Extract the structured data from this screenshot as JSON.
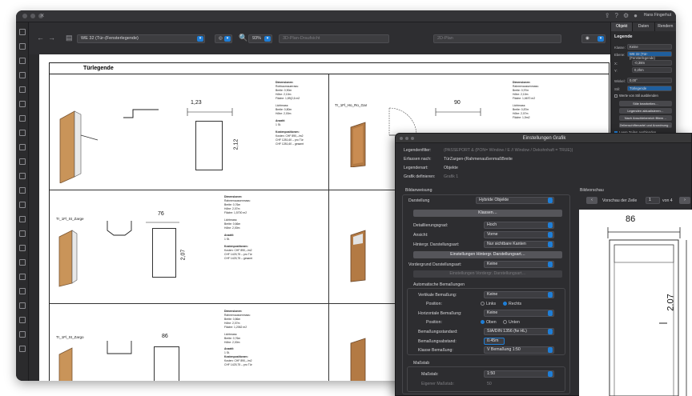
{
  "window": {
    "user_label": "Hans Fingerhut"
  },
  "toolbar": {
    "layer_prefix": "WE 32",
    "layer_name": "WE 32 (Tür-(Fensterlegende)",
    "zoom": "93%",
    "view_placeholder": "3D-Plan-Draufsicht",
    "class_placeholder": "2D-Plan"
  },
  "sheet": {
    "title": "Türlegende",
    "rows": [
      {
        "left_label": "",
        "right_label": "Tr_1Fl_Ho_Ro_Gar",
        "left_dim_w": "1,23",
        "left_dim_h": "2,12",
        "right_dim_w": "90",
        "left_spec": [
          "Dimensionen:",
          "Rohbaumauerrass:",
          "Breite: 0,90m",
          "Höhe: 2,10m",
          "Fläche: 1,89(2,6 m2",
          "Lichtmass:",
          "Breite: 0,80m",
          "Höhe: 2,00m",
          "Anzahl:",
          "1 St.",
          "Kostenpositionen:",
          "Kosten: CHF 890,–/m2",
          "CHF 1281,60 – pro Tür",
          "CHF 1281,60 – gesamt"
        ],
        "right_spec": [
          "Dimensionen:",
          "Rahmenaussenmass:",
          "Breite: 0,97m",
          "Höhe: 2,10m",
          "Fläche: 1,6670 m2",
          "Lichtmass:",
          "Breite: 0,87m",
          "Höhe: 2,07m",
          "Fläche: 1,5m2"
        ]
      },
      {
        "left_label": "Tr_1Fl_St_Zarge",
        "right_label": "",
        "left_dim_w": "76",
        "left_dim_h": "2,07",
        "right_dim_w": "",
        "left_spec": [
          "Dimensionen:",
          "Rahmenaussenmass:",
          "Breite: 0,76m",
          "Höhe: 2,07m",
          "Fläche: 1,5700 m2",
          "Lichtmass:",
          "Breite: 0,66m",
          "Höhe: 2,00m",
          "Anzahl:",
          "1 St.",
          "Kostenpositionen:",
          "Kosten: CHF 890,–/m2",
          "CHF 1425,75 – pro Tür",
          "CHF 1425,75 – gesamt"
        ],
        "right_spec": []
      },
      {
        "left_label": "Tr_1Fl_St_Zargo",
        "right_label": "",
        "left_dim_w": "86",
        "left_dim_h": "",
        "right_dim_w": "",
        "left_spec": [
          "Dimensionen:",
          "Rahmenaussenmass:",
          "Breite: 0,86m",
          "Höhe: 2,07m",
          "Fläche: 1,2062 m2",
          "Lichtmass:",
          "Breite: 0,76m",
          "Höhe: 2,00m",
          "Anzahl:",
          "1 St.",
          "Kostenpositionen:",
          "Kosten: CHF 890,–/m2",
          "CHF 1425,75 – pro Tür"
        ],
        "right_spec": []
      }
    ]
  },
  "right_panel": {
    "tabs": [
      "Objekt",
      "Daten",
      "Rendern"
    ],
    "active_tab": "Objekt",
    "heading": "Legende",
    "fields": [
      {
        "label": "Klasse:",
        "value": "Keine"
      },
      {
        "label": "Ebene:",
        "value": "WE 32 (Tür-(Fensterlegende)"
      },
      {
        "label": "X:",
        "value": "-0,38m"
      },
      {
        "label": "Y:",
        "value": "0,2hm"
      },
      {
        "label": "Winkel:",
        "value": "0,00°"
      },
      {
        "label": "Stil:",
        "value": "Türlegende"
      }
    ],
    "checkbox_1": "Werte von Stil ausblenden",
    "buttons": [
      "Stile bearbeiten…",
      "Legenden aktualisieren…",
      "Nach Anschlebereich filtern…",
      "Zeilenschiftenartel und Anordnung…"
    ],
    "checkbox_2": "Leere Zeilen ausblenden"
  },
  "dialog": {
    "title": "Einstellungen Grafik",
    "rows": [
      {
        "label": "Legendenfilter:",
        "value": "(PASSEPORT & (PON= Window / E // Window / Dekohnhaft = TRUE))"
      },
      {
        "label": "Erfassen nach:",
        "value": "TürZargen-(RahmenaußenmaßBreite"
      },
      {
        "label": "Legendenart:",
        "value": "Objekte"
      },
      {
        "label": "Grafik definieren:",
        "value": "Grafik 1"
      }
    ],
    "section_left": "Bildanweisung",
    "section_right": "Bildvorschau",
    "darstellung_label": "Darstellung",
    "darstellung_value": "Hybride Objekte",
    "klassen_btn": "Klassen…",
    "detail_label": "Detaillierungsgrad:",
    "detail_value": "Hoch",
    "ansicht_label": "Ansicht:",
    "ansicht_value": "Vorne",
    "hinter_label": "Hintergr. Darstellungsart:",
    "hinter_value": "Nur sichtbare Kanten",
    "hinter_btn": "Einstellungen Hintergr. Darstellungsart…",
    "vorder_label": "Vordergrund Darstellungsart:",
    "vorder_value": "Keine",
    "vorder_btn": "Einstellungen Vordergr. Darstellungsart…",
    "auto_heading": "Automatische Bemaßungen",
    "vert_label": "Vertikale Bemaßung:",
    "vert_value": "Keine",
    "pos_label": "Position:",
    "pos_opts": [
      "Links",
      "Rechts"
    ],
    "hor_label": "Horizontale Bemaßung:",
    "hor_value": "Keine",
    "pos2_opts": [
      "Oben",
      "Unten"
    ],
    "std_label": "Bemaßungsstandard:",
    "std_value": "SIA/DIN 1356 (fw HL)",
    "abst_label": "Bemaßungsabstand:",
    "abst_value": "0.45m",
    "kl_label": "Klasse Bemaßung:",
    "kl_value": "V Bemaßung 1:50",
    "mass_heading": "Maßstab",
    "mass_label": "Maßstab:",
    "mass_value": "1:50",
    "eig_label": "Eigener Maßstab:",
    "eig_value": "50",
    "prev_prev": "‹",
    "prev_label": "Vorschau der Zeile",
    "prev_num": "1",
    "prev_von": "von 4",
    "prev_next": "›",
    "prev_dim_w": "86",
    "prev_dim_h": "2.07"
  }
}
